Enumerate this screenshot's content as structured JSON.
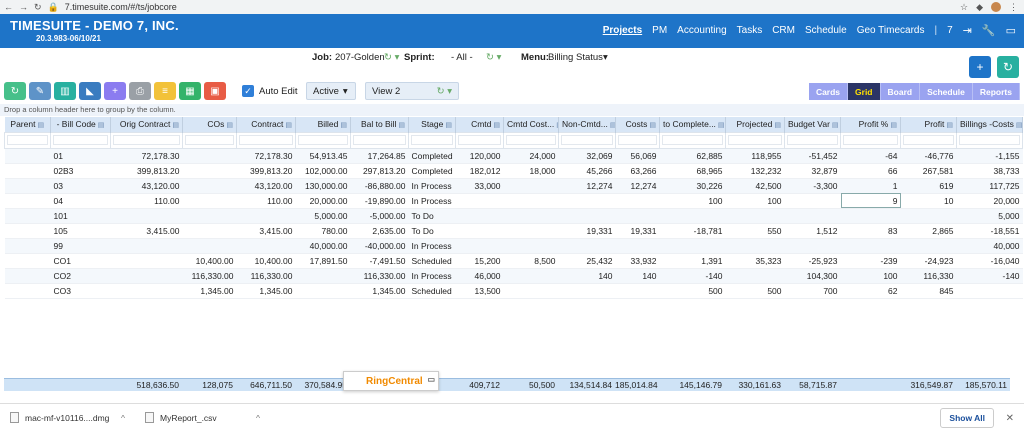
{
  "browser": {
    "url": "7.timesuite.com/#/ts/jobcore"
  },
  "app": {
    "title": "TIMESUITE - DEMO 7, INC.",
    "version": "20.3.983-06/10/21",
    "nav": [
      "Projects",
      "PM",
      "Accounting",
      "Tasks",
      "CRM",
      "Schedule",
      "Geo Timecards"
    ],
    "active_nav": "Projects",
    "badge": "7",
    "brand_color": "#1e74c8"
  },
  "filters": {
    "job_label": "Job:",
    "job_value": "207-Golden",
    "sprint_label": "Sprint:",
    "sprint_value": "- All -",
    "menu_label": "Menu:",
    "menu_value": "Billing Status"
  },
  "toolbar": {
    "buttons": [
      {
        "icon": "refresh-icon",
        "color": "#46c08a"
      },
      {
        "icon": "edit-icon",
        "color": "#5e93c8"
      },
      {
        "icon": "columns-icon",
        "color": "#28b0a0"
      },
      {
        "icon": "filter-icon",
        "color": "#3a7cc0"
      },
      {
        "icon": "add-icon",
        "color": "#8b7cf0"
      },
      {
        "icon": "print-icon",
        "color": "#9aa0a6"
      },
      {
        "icon": "sort-icon",
        "color": "#f2c23a"
      },
      {
        "icon": "grid-icon",
        "color": "#34b36a"
      },
      {
        "icon": "export-icon",
        "color": "#e85c45"
      }
    ],
    "auto_edit_label": "Auto Edit",
    "status_value": "Active",
    "view_value": "View 2"
  },
  "views": [
    "Cards",
    "Grid",
    "Board",
    "Schedule",
    "Reports"
  ],
  "active_view": "Grid",
  "group_hint": "Drop a column header here to group by the column.",
  "grid": {
    "columns": [
      "Parent",
      "- Bill Code",
      "Orig Contract",
      "COs",
      "Contract",
      "Billed",
      "Bal to Bill",
      "Stage",
      "Cmtd",
      "Cmtd Cost...",
      "Non-Cmtd...",
      "Costs",
      "to Complete...",
      "Projected",
      "Budget Var",
      "Profit %",
      "Profit",
      "Billings -Costs"
    ],
    "rows": [
      [
        "",
        "01",
        "72,178.30",
        "",
        "72,178.30",
        "54,913.45",
        "17,264.85",
        "Completed",
        "120,000",
        "24,000",
        "32,069",
        "56,069",
        "62,885",
        "118,955",
        "-51,452",
        "-64",
        "-46,776",
        "-1,155"
      ],
      [
        "",
        "02B3",
        "399,813.20",
        "",
        "399,813.20",
        "102,000.00",
        "297,813.20",
        "Completed",
        "182,012",
        "18,000",
        "45,266",
        "63,266",
        "68,965",
        "132,232",
        "32,879",
        "66",
        "267,581",
        "38,733"
      ],
      [
        "",
        "03",
        "43,120.00",
        "",
        "43,120.00",
        "130,000.00",
        "-86,880.00",
        "In Process",
        "33,000",
        "",
        "12,274",
        "12,274",
        "30,226",
        "42,500",
        "-3,300",
        "1",
        "619",
        "117,725"
      ],
      [
        "",
        "04",
        "110.00",
        "",
        "110.00",
        "20,000.00",
        "-19,890.00",
        "In Process",
        "",
        "",
        "",
        "",
        "100",
        "100",
        "",
        "9",
        "10",
        "20,000"
      ],
      [
        "",
        "101",
        "",
        "",
        "",
        "5,000.00",
        "-5,000.00",
        "To Do",
        "",
        "",
        "",
        "",
        "",
        "",
        "",
        "",
        "",
        "5,000"
      ],
      [
        "",
        "105",
        "3,415.00",
        "",
        "3,415.00",
        "780.00",
        "2,635.00",
        "To Do",
        "",
        "",
        "19,331",
        "19,331",
        "-18,781",
        "550",
        "1,512",
        "83",
        "2,865",
        "-18,551"
      ],
      [
        "",
        "99",
        "",
        "",
        "",
        "40,000.00",
        "-40,000.00",
        "In Process",
        "",
        "",
        "",
        "",
        "",
        "",
        "",
        "",
        "",
        "40,000"
      ],
      [
        "",
        "CO1",
        "",
        "10,400.00",
        "10,400.00",
        "17,891.50",
        "-7,491.50",
        "Scheduled",
        "15,200",
        "8,500",
        "25,432",
        "33,932",
        "1,391",
        "35,323",
        "-25,923",
        "-239",
        "-24,923",
        "-16,040"
      ],
      [
        "",
        "CO2",
        "",
        "116,330.00",
        "116,330.00",
        "",
        "116,330.00",
        "In Process",
        "46,000",
        "",
        "140",
        "140",
        "-140",
        "",
        "104,300",
        "100",
        "116,330",
        "-140"
      ],
      [
        "",
        "CO3",
        "",
        "1,345.00",
        "1,345.00",
        "",
        "1,345.00",
        "Scheduled",
        "13,500",
        "",
        "",
        "",
        "500",
        "500",
        "700",
        "62",
        "845",
        ""
      ]
    ],
    "totals": [
      "",
      "",
      "518,636.50",
      "128,075",
      "646,711.50",
      "370,584.95",
      "",
      "",
      "409,712",
      "50,500",
      "134,514.84",
      "185,014.84",
      "145,146.79",
      "330,161.63",
      "58,715.87",
      "",
      "316,549.87",
      "185,570.11"
    ]
  },
  "popup": {
    "label": "RingCentral"
  },
  "downloads": {
    "items": [
      "mac-mf-v10116....dmg",
      "MyReport_.csv"
    ],
    "show_all": "Show All"
  }
}
